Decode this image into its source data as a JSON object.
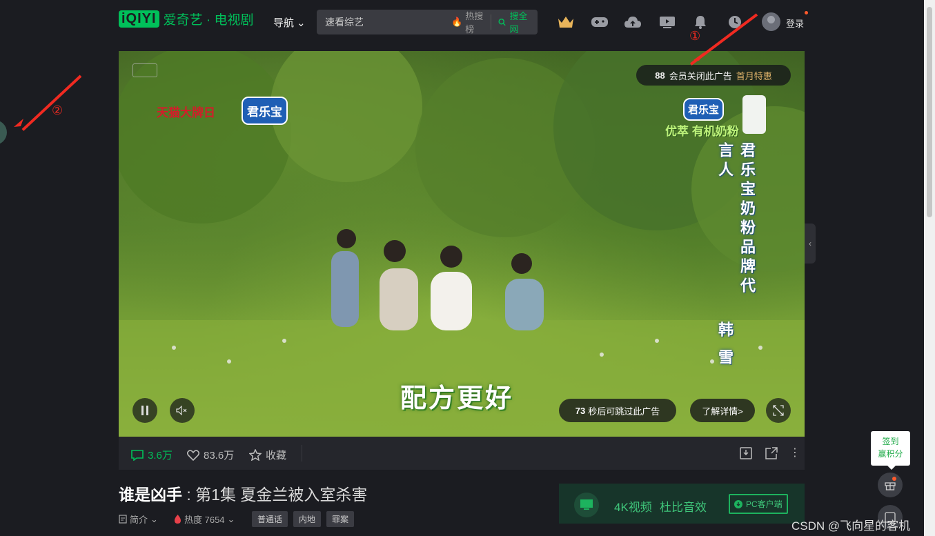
{
  "header": {
    "logo_box": "iQIYI",
    "logo_text": "爱奇艺 · 电视剧",
    "nav_label": "导航",
    "search_placeholder": "速看综艺",
    "hot_label": "热搜榜",
    "search_button": "搜全网",
    "icons": [
      "vip-crown-icon",
      "game-icon",
      "cloud-upload-icon",
      "video-icon",
      "bell-icon",
      "history-icon"
    ],
    "login_label": "登录"
  },
  "video": {
    "member_badge": "88",
    "member_text": "会员关闭此广告",
    "member_offer": "首月特惠",
    "brand_tmall": "天猫大牌日",
    "brand_name": "君乐宝",
    "brand_name_right": "君乐宝",
    "sub_slogan": "优萃 有机奶粉",
    "vertical_text": "君乐宝奶粉品牌代言人",
    "spokesperson": "韩 雪",
    "slogan": "配方更好",
    "skip_count": "73",
    "skip_text": "秒后可跳过此广告",
    "details_button": "了解详情>"
  },
  "bar": {
    "comments": "3.6万",
    "likes": "83.6万",
    "collect": "收藏"
  },
  "title": {
    "show": "谁是凶手",
    "separator": " : ",
    "episode": "第1集 夏金兰被入室杀害"
  },
  "meta": {
    "intro": "简介",
    "heat": "热度 7654",
    "tags": [
      "普通话",
      "内地",
      "罪案"
    ]
  },
  "promo": {
    "text1": "4K视频",
    "text2": "杜比音效",
    "button": "PC客户端"
  },
  "signin": {
    "line1": "签到",
    "line2": "赢积分"
  },
  "annotations": {
    "one": "①",
    "two": "②"
  },
  "watermark": "CSDN @飞向星的客机",
  "colors": {
    "accent_green": "#00c05a",
    "background": "#1b1c21",
    "annotation_red": "#f02a21",
    "offer_gold": "#e2b56b"
  }
}
